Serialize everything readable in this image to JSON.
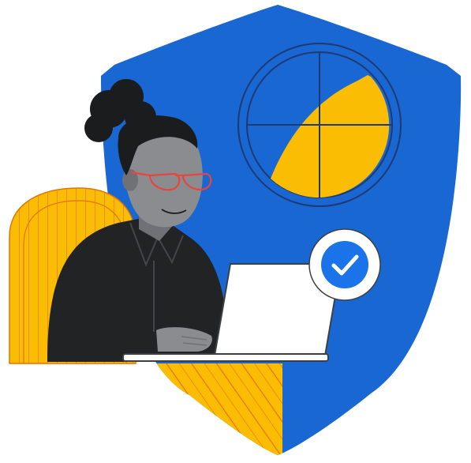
{
  "illustration": {
    "subject": "security-shield-with-person-at-laptop",
    "icons": [
      "shield-icon",
      "radar-icon",
      "checkmark-badge-icon",
      "laptop-icon"
    ]
  },
  "colors": {
    "shield_blue": "#1967D2",
    "accent_yellow": "#FBBC04",
    "chair_stroke": "#E37400",
    "outline_dark": "#1F3A73",
    "skin": "#8A8C90",
    "skin_shadow": "#6F7176",
    "hair": "#1B1C1E",
    "shirt": "#222325",
    "glasses": "#E8453C",
    "laptop": "#FFFFFF",
    "check_blue": "#1A73E8"
  }
}
